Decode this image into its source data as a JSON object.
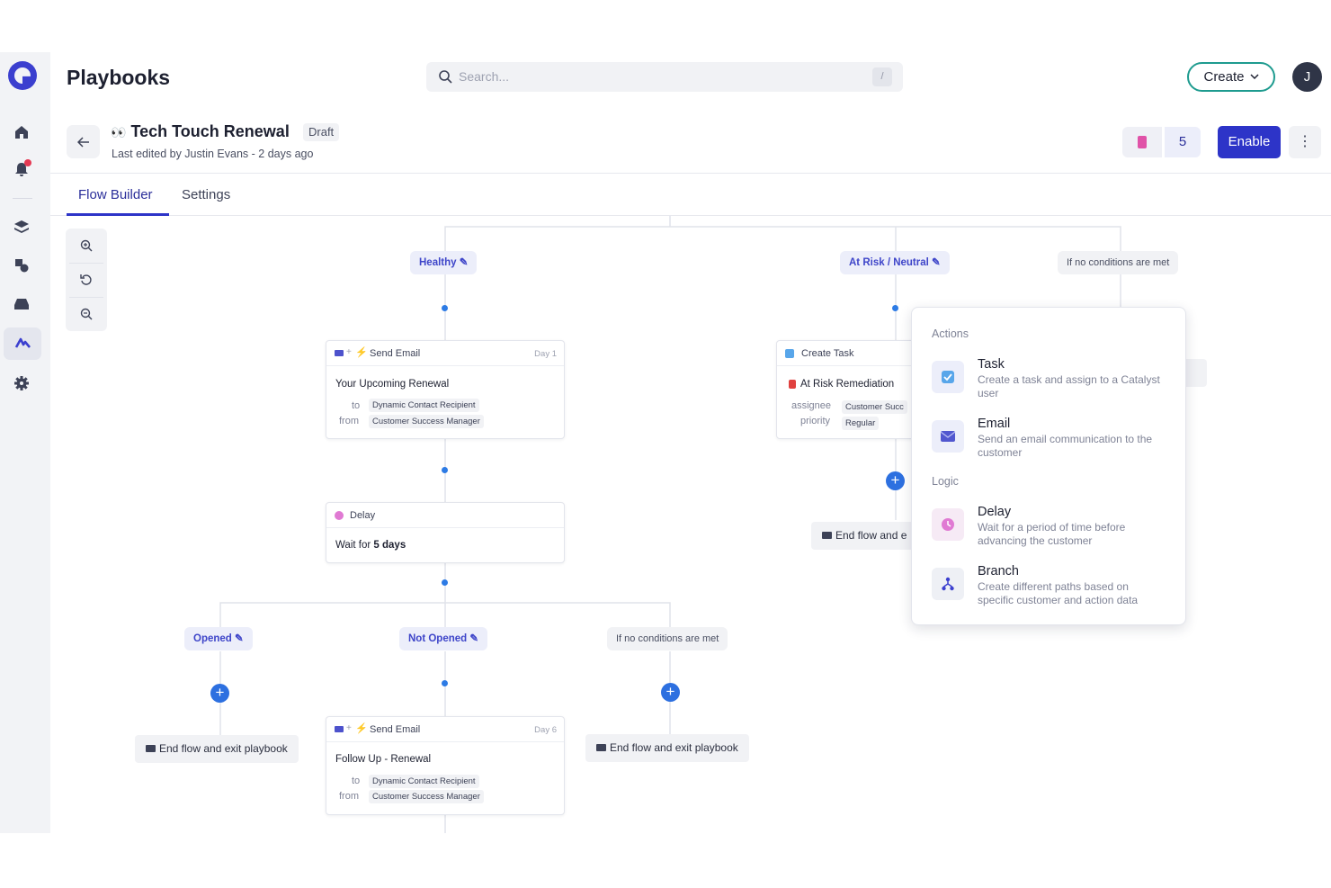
{
  "app": {
    "title": "Playbooks"
  },
  "search": {
    "placeholder": "Search...",
    "shortcut": "/"
  },
  "header": {
    "create_label": "Create",
    "avatar_initial": "J"
  },
  "playbook": {
    "emoji": "👀",
    "name": "Tech Touch Renewal",
    "status": "Draft",
    "last_edited": "Last edited by Justin Evans - 2 days ago",
    "count": "5",
    "enable_label": "Enable"
  },
  "tabs": [
    {
      "label": "Flow Builder",
      "active": true
    },
    {
      "label": "Settings",
      "active": false
    }
  ],
  "flow": {
    "branch_healthy": "Healthy",
    "branch_at_risk": "At Risk / Neutral",
    "branch_no_conditions": "If no conditions are met",
    "email1": {
      "type": "Send Email",
      "day": "Day 1",
      "subject": "Your Upcoming Renewal",
      "to_label": "to",
      "to_value": "Dynamic Contact Recipient",
      "from_label": "from",
      "from_value": "Customer Success Manager"
    },
    "task": {
      "type": "Create Task",
      "subject": "At Risk Remediation",
      "assignee_label": "assignee",
      "assignee_value": "Customer Succ",
      "priority_label": "priority",
      "priority_value": "Regular"
    },
    "end_truncated": "End flow and e",
    "delay": {
      "type": "Delay",
      "text_prefix": "Wait for",
      "text_value": "5 days"
    },
    "branch_opened": "Opened",
    "branch_not_opened": "Not Opened",
    "branch_no_conditions_2": "If no conditions are met",
    "end_label": "End flow and exit playbook",
    "email2": {
      "type": "Send Email",
      "day": "Day 6",
      "subject": "Follow Up - Renewal",
      "to_label": "to",
      "to_value": "Dynamic Contact Recipient",
      "from_label": "from",
      "from_value": "Customer Success Manager"
    }
  },
  "action_menu": {
    "actions_heading": "Actions",
    "logic_heading": "Logic",
    "items": [
      {
        "icon": "task-icon",
        "title": "Task",
        "desc": "Create a task and assign to a Catalyst user"
      },
      {
        "icon": "email-icon",
        "title": "Email",
        "desc": "Send an email communication to the customer"
      },
      {
        "icon": "delay-icon",
        "title": "Delay",
        "desc": "Wait for a period of time before advancing the customer"
      },
      {
        "icon": "branch-icon",
        "title": "Branch",
        "desc": "Create different paths based on specific customer and action data"
      }
    ]
  },
  "colors": {
    "accent": "#2d34c8",
    "pill_bg": "#eceefa",
    "pill_text": "#3e45c9",
    "node_dot": "#2d7be5"
  }
}
